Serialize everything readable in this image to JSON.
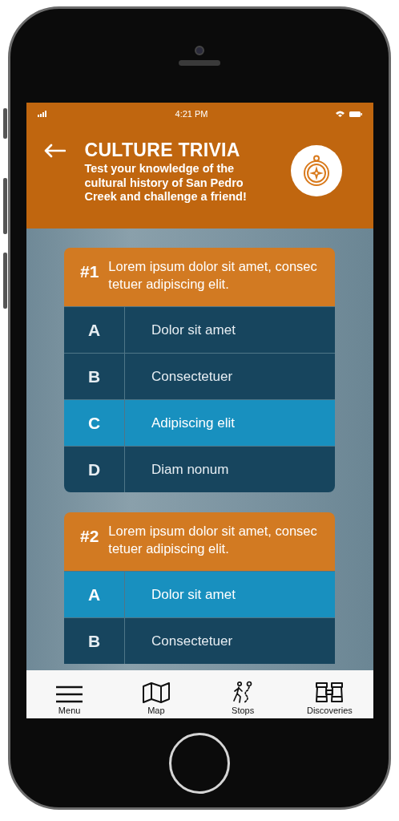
{
  "status_bar": {
    "time": "4:21 PM"
  },
  "header": {
    "title": "CULTURE TRIVIA",
    "subtitle": "Test your knowledge of the cultural history of San Pedro Creek and challenge a friend!"
  },
  "questions": [
    {
      "number": "#1",
      "text": "Lorem ipsum dolor sit amet, consec tetuer adipiscing elit.",
      "answers": [
        {
          "letter": "A",
          "text": "Dolor sit amet",
          "selected": false
        },
        {
          "letter": "B",
          "text": "Consectetuer",
          "selected": false
        },
        {
          "letter": "C",
          "text": "Adipiscing elit",
          "selected": true
        },
        {
          "letter": "D",
          "text": "Diam nonum",
          "selected": false
        }
      ]
    },
    {
      "number": "#2",
      "text": "Lorem ipsum dolor sit amet, consec tetuer adipiscing elit.",
      "answers": [
        {
          "letter": "A",
          "text": "Dolor sit amet",
          "selected": true
        },
        {
          "letter": "B",
          "text": "Consectetuer",
          "selected": false
        }
      ]
    }
  ],
  "tab_bar": [
    {
      "label": "Menu",
      "kind": "menu"
    },
    {
      "label": "Map",
      "kind": "map"
    },
    {
      "label": "Stops",
      "kind": "stops"
    },
    {
      "label": "Discoveries",
      "kind": "discoveries"
    }
  ]
}
